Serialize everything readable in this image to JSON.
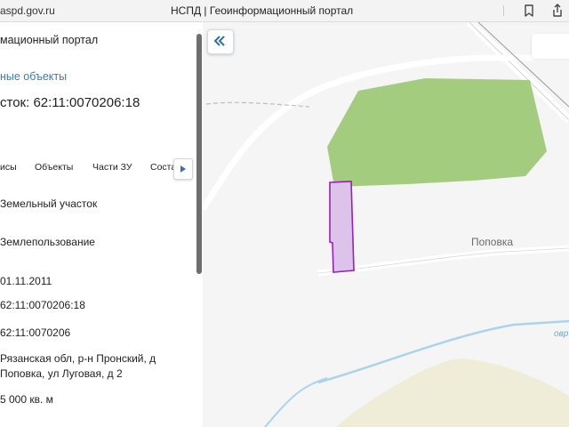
{
  "browser": {
    "url": "aspd.gov.ru",
    "tab_title": "НСПД | Геоинформационный портал"
  },
  "panel": {
    "portal_title": "мационный портал",
    "related_link": "ные объекты",
    "heading": "сток: 62:11:0070206:18",
    "tabs": [
      "исы",
      "Объекты",
      "Части ЗУ",
      "Соста"
    ],
    "fields": [
      "Земельный участок",
      "Землепользование",
      "01.11.2011",
      "62:11:0070206:18",
      "62:11:0070206",
      "Рязанская обл, р-н Пронский, д",
      "Поповка, ул Луговая, д 2",
      "5 000 кв. м"
    ]
  },
  "map": {
    "place_label": "Поповка",
    "river_label_partial": "овр",
    "colors": {
      "forest": "#a3cc7f",
      "parcel_fill": "#dcc3ea",
      "parcel_stroke": "#9b1fb8",
      "road": "#ffffff",
      "water": "#a9d4ec",
      "field": "#efedd8",
      "background": "#f5f5f5"
    }
  },
  "icons": {
    "bookmark": "bookmark-icon",
    "share": "share-icon",
    "collapse": "double-chevron-left-icon",
    "tab_scroll": "triangle-right-icon"
  }
}
